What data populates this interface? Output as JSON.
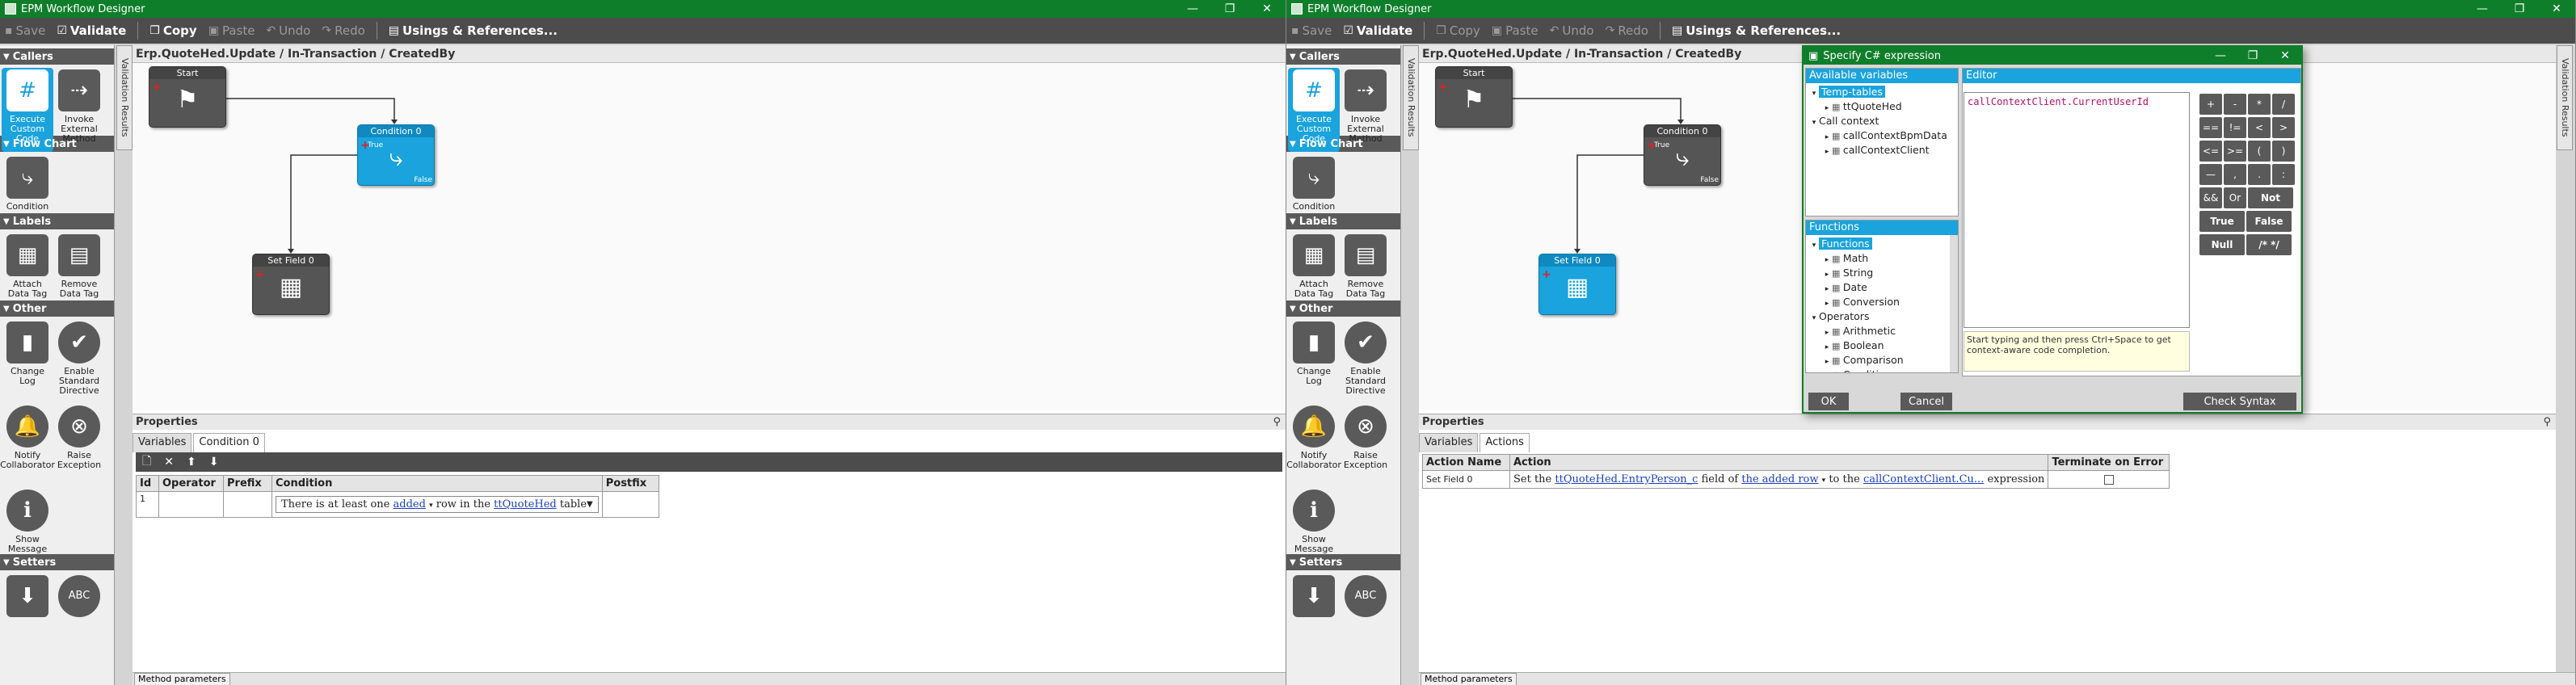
{
  "app_title": "EPM Workflow Designer",
  "window_controls": [
    "—",
    "❐",
    "✕"
  ],
  "toolbar": {
    "save": "Save",
    "validate": "Validate",
    "copy": "Copy",
    "paste": "Paste",
    "undo": "Undo",
    "redo": "Redo",
    "usings": "Usings & References..."
  },
  "toolbox": {
    "groups": [
      {
        "label": "Callers",
        "tools": [
          {
            "label": "Execute Custom Code",
            "icon": "#"
          },
          {
            "label": "Invoke External Method",
            "icon": "⇢"
          }
        ]
      },
      {
        "label": "Flow Chart",
        "tools": [
          {
            "label": "Condition",
            "icon": "⤷"
          }
        ]
      },
      {
        "label": "Labels",
        "tools": [
          {
            "label": "Attach Data Tag",
            "icon": "▦"
          },
          {
            "label": "Remove Data Tag",
            "icon": "▤"
          }
        ]
      },
      {
        "label": "Other",
        "tools": [
          {
            "label": "Change Log",
            "icon": "▮"
          },
          {
            "label": "Enable Standard Directive",
            "icon": "✔"
          },
          {
            "label": "Notify Collaborator",
            "icon": "🔔"
          },
          {
            "label": "Raise Exception",
            "icon": "⊗"
          },
          {
            "label": "Show Message",
            "icon": "ℹ"
          }
        ]
      },
      {
        "label": "Setters",
        "tools": [
          {
            "label": "",
            "icon": "⬇"
          },
          {
            "label": "",
            "icon": "ABC"
          }
        ]
      }
    ]
  },
  "validation_tab": "Validation Results",
  "breadcrumb": "Erp.QuoteHed.Update / In-Transaction / CreatedBy",
  "nodes": {
    "start": "Start",
    "condition": "Condition 0",
    "set_field": "Set Field 0",
    "true_label": "True",
    "false_label": "False"
  },
  "properties": {
    "header": "Properties",
    "pin": "⚲",
    "left_tabs": [
      "Variables",
      "Condition 0"
    ],
    "right_tabs": [
      "Variables",
      "Actions"
    ],
    "condition_table": {
      "columns": [
        "Id",
        "Operator",
        "Prefix",
        "Condition",
        "Postfix"
      ],
      "row": {
        "id": "1",
        "prefix_text": "There is at least one",
        "link1": "added",
        "mid_text": "row in the",
        "link2": "ttQuoteHed",
        "suffix_text": "table"
      }
    },
    "actions_table": {
      "columns": [
        "Action Name",
        "Action",
        "Terminate on Error"
      ],
      "row": {
        "name": "Set Field 0",
        "t1": "Set the",
        "link1": "ttQuoteHed.EntryPerson_c",
        "t2": "field of",
        "link2": "the added row",
        "t3": "to the",
        "link3": "callContextClient.Cu...",
        "t4": "expression"
      }
    }
  },
  "status_tab": "Method parameters",
  "dialog": {
    "title": "Specify C# expression",
    "available_vars": "Available variables",
    "editor": "Editor",
    "functions_hdr": "Functions",
    "tree_vars": [
      {
        "label": "Temp-tables",
        "level": 0,
        "arrow": "▾",
        "hl": true
      },
      {
        "label": "ttQuoteHed",
        "level": 1,
        "arrow": "▸",
        "hl": false
      },
      {
        "label": "Call context",
        "level": 0,
        "arrow": "▾",
        "hl": false
      },
      {
        "label": "callContextBpmData",
        "level": 1,
        "arrow": "▸",
        "hl": false
      },
      {
        "label": "callContextClient",
        "level": 1,
        "arrow": "▸",
        "hl": false
      }
    ],
    "tree_funcs": [
      {
        "label": "Functions",
        "level": 0,
        "arrow": "▾",
        "hl": true
      },
      {
        "label": "Math",
        "level": 1,
        "arrow": "▸",
        "hl": false
      },
      {
        "label": "String",
        "level": 1,
        "arrow": "▸",
        "hl": false
      },
      {
        "label": "Date",
        "level": 1,
        "arrow": "▸",
        "hl": false
      },
      {
        "label": "Conversion",
        "level": 1,
        "arrow": "▸",
        "hl": false
      },
      {
        "label": "Operators",
        "level": 0,
        "arrow": "▾",
        "hl": false
      },
      {
        "label": "Arithmetic",
        "level": 1,
        "arrow": "▸",
        "hl": false
      },
      {
        "label": "Boolean",
        "level": 1,
        "arrow": "▸",
        "hl": false
      },
      {
        "label": "Comparison",
        "level": 1,
        "arrow": "▸",
        "hl": false
      },
      {
        "label": "Condition",
        "level": 1,
        "arrow": "▸",
        "hl": false
      }
    ],
    "expression": "callContextClient.CurrentUserId",
    "hint": "Start typing and then press Ctrl+Space to get context-aware code completion.",
    "keys": [
      "+",
      "-",
      "*",
      "/",
      "==",
      "!=",
      "<",
      ">",
      "<=",
      ">=",
      "(",
      ")",
      "—",
      ",",
      ".",
      ":",
      "&&",
      "||",
      "!",
      "%"
    ],
    "wide_keys": [
      "True",
      "False",
      "Null",
      "/* */"
    ],
    "keys_row_or": [
      "Or",
      "Not"
    ],
    "ok": "OK",
    "cancel": "Cancel",
    "check": "Check Syntax"
  }
}
